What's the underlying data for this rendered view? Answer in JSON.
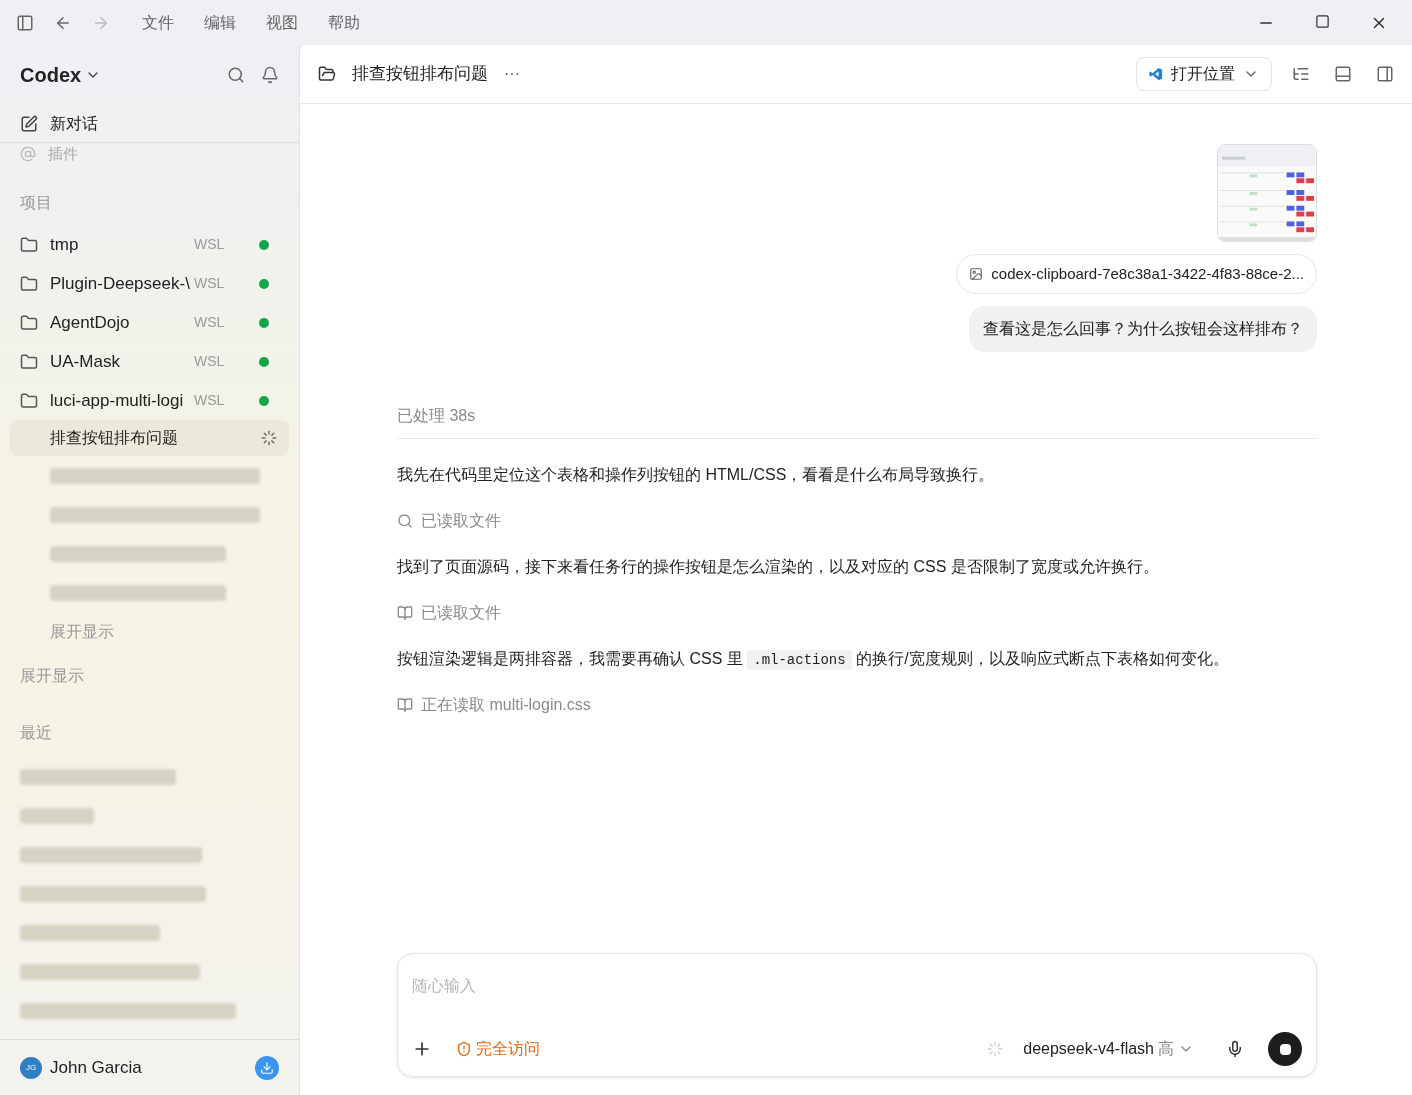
{
  "menu": [
    "文件",
    "编辑",
    "视图",
    "帮助"
  ],
  "sidebar": {
    "brand": "Codex",
    "new_chat": "新对话",
    "plugins": "插件",
    "projects_heading": "项目",
    "projects": [
      {
        "name": "tmp",
        "env": "WSL",
        "color": "#16a34a"
      },
      {
        "name": "Plugin-Deepseek-\\",
        "env": "WSL",
        "color": "#16a34a"
      },
      {
        "name": "AgentDojo",
        "env": "WSL",
        "color": "#16a34a"
      },
      {
        "name": "UA-Mask",
        "env": "WSL",
        "color": "#16a34a"
      },
      {
        "name": "luci-app-multi-logi",
        "env": "WSL",
        "color": "#16a34a",
        "threads": [
          {
            "kind": "thread",
            "title": "排查按钮排布问题",
            "selected": true,
            "running": true
          },
          {
            "kind": "redacted"
          },
          {
            "kind": "redacted"
          },
          {
            "kind": "redacted"
          },
          {
            "kind": "redacted"
          }
        ],
        "expand": "展开显示"
      }
    ],
    "projects_expand": "展开显示",
    "recent_heading": "最近",
    "recent": [
      {
        "kind": "redacted"
      },
      {
        "kind": "redacted"
      },
      {
        "kind": "redacted"
      },
      {
        "kind": "redacted"
      },
      {
        "kind": "redacted"
      },
      {
        "kind": "redacted"
      },
      {
        "kind": "redacted"
      }
    ],
    "user": {
      "initials": "JG",
      "name": "John Garcia"
    }
  },
  "header": {
    "title": "排查按钮排布问题",
    "more": "···",
    "open_button": "打开位置"
  },
  "chat": {
    "attachment": {
      "kind": "picture",
      "filename": "codex-clipboard-7e8c38a1-3422-4f83-88ce-2..."
    },
    "user_message": "查看这是怎么回事？为什么按钮会这样排布？",
    "processed": "已处理 38s",
    "steps": [
      {
        "kind": "text",
        "text": "我先在代码里定位这个表格和操作列按钮的 HTML/CSS，看看是什么布局导致换行。"
      },
      {
        "kind": "search",
        "text": "已读取文件"
      },
      {
        "kind": "text",
        "text": "找到了页面源码，接下来看任务行的操作按钮是怎么渲染的，以及对应的 CSS 是否限制了宽度或允许换行。"
      },
      {
        "kind": "read",
        "text": "已读取文件"
      },
      {
        "kind": "code_text",
        "before": "按钮渲染逻辑是两排容器，我需要再确认 CSS 里",
        "code": ".ml-actions",
        "after": "的换行/宽度规则，以及响应式断点下表格如何变化。"
      },
      {
        "kind": "read",
        "text": "正在读取 multi-login.css"
      }
    ]
  },
  "composer": {
    "placeholder": "随心输入",
    "access": "完全访问",
    "model": "deepseek-v4-flash",
    "effort": "高"
  }
}
